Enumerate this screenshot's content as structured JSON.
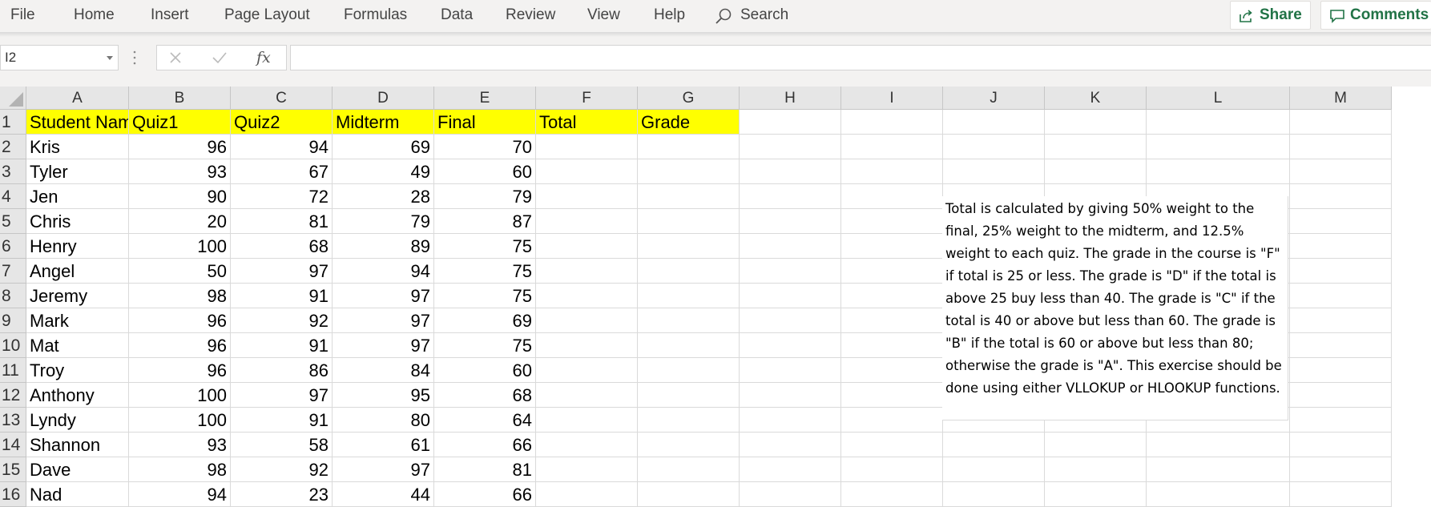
{
  "ribbon": {
    "tabs": [
      "File",
      "Home",
      "Insert",
      "Page Layout",
      "Formulas",
      "Data",
      "Review",
      "View",
      "Help"
    ],
    "search_label": "Search",
    "share_label": "Share",
    "comments_label": "Comments",
    "accent_color": "#217346"
  },
  "formula_bar": {
    "name_box": "I2",
    "fx_label": "fx",
    "formula": ""
  },
  "sheet": {
    "columns": [
      "A",
      "B",
      "C",
      "D",
      "E",
      "F",
      "G",
      "H",
      "I",
      "J",
      "K",
      "L",
      "M"
    ],
    "row_numbers": [
      "1",
      "2",
      "3",
      "4",
      "5",
      "6",
      "7",
      "8",
      "9",
      "10",
      "11",
      "12",
      "13",
      "14",
      "15",
      "16"
    ],
    "header_row": [
      "Student Name",
      "Quiz1",
      "Quiz2",
      "Midterm",
      "Final",
      "Total",
      "Grade"
    ],
    "header_fill": "#ffff00",
    "data_rows": [
      [
        "Kris",
        "96",
        "94",
        "69",
        "70"
      ],
      [
        "Tyler",
        "93",
        "67",
        "49",
        "60"
      ],
      [
        "Jen",
        "90",
        "72",
        "28",
        "79"
      ],
      [
        "Chris",
        "20",
        "81",
        "79",
        "87"
      ],
      [
        "Henry",
        "100",
        "68",
        "89",
        "75"
      ],
      [
        "Angel",
        "50",
        "97",
        "94",
        "75"
      ],
      [
        "Jeremy",
        "98",
        "91",
        "97",
        "75"
      ],
      [
        "Mark",
        "96",
        "92",
        "97",
        "69"
      ],
      [
        "Mat",
        "96",
        "91",
        "97",
        "75"
      ],
      [
        "Troy",
        "96",
        "86",
        "84",
        "60"
      ],
      [
        "Anthony",
        "100",
        "97",
        "95",
        "68"
      ],
      [
        "Lyndy",
        "100",
        "91",
        "80",
        "64"
      ],
      [
        "Shannon",
        "93",
        "58",
        "61",
        "66"
      ],
      [
        "Dave",
        "98",
        "92",
        "97",
        "81"
      ],
      [
        "Nad",
        "94",
        "23",
        "44",
        "66"
      ]
    ],
    "note": "Total is calculated by giving 50% weight to the final, 25% weight to the midterm, and 12.5% weight to each quiz. The grade in the course is \"F\" if total is 25 or less. The grade is \"D\" if the total is above 25 buy less than 40. The grade is \"C\" if the total is 40 or above but less than 60. The grade is \"B\" if the total is 60 or above but less than 80; otherwise the grade is \"A\". This exercise should be done using either VLLOKUP or HLOOKUP functions."
  }
}
